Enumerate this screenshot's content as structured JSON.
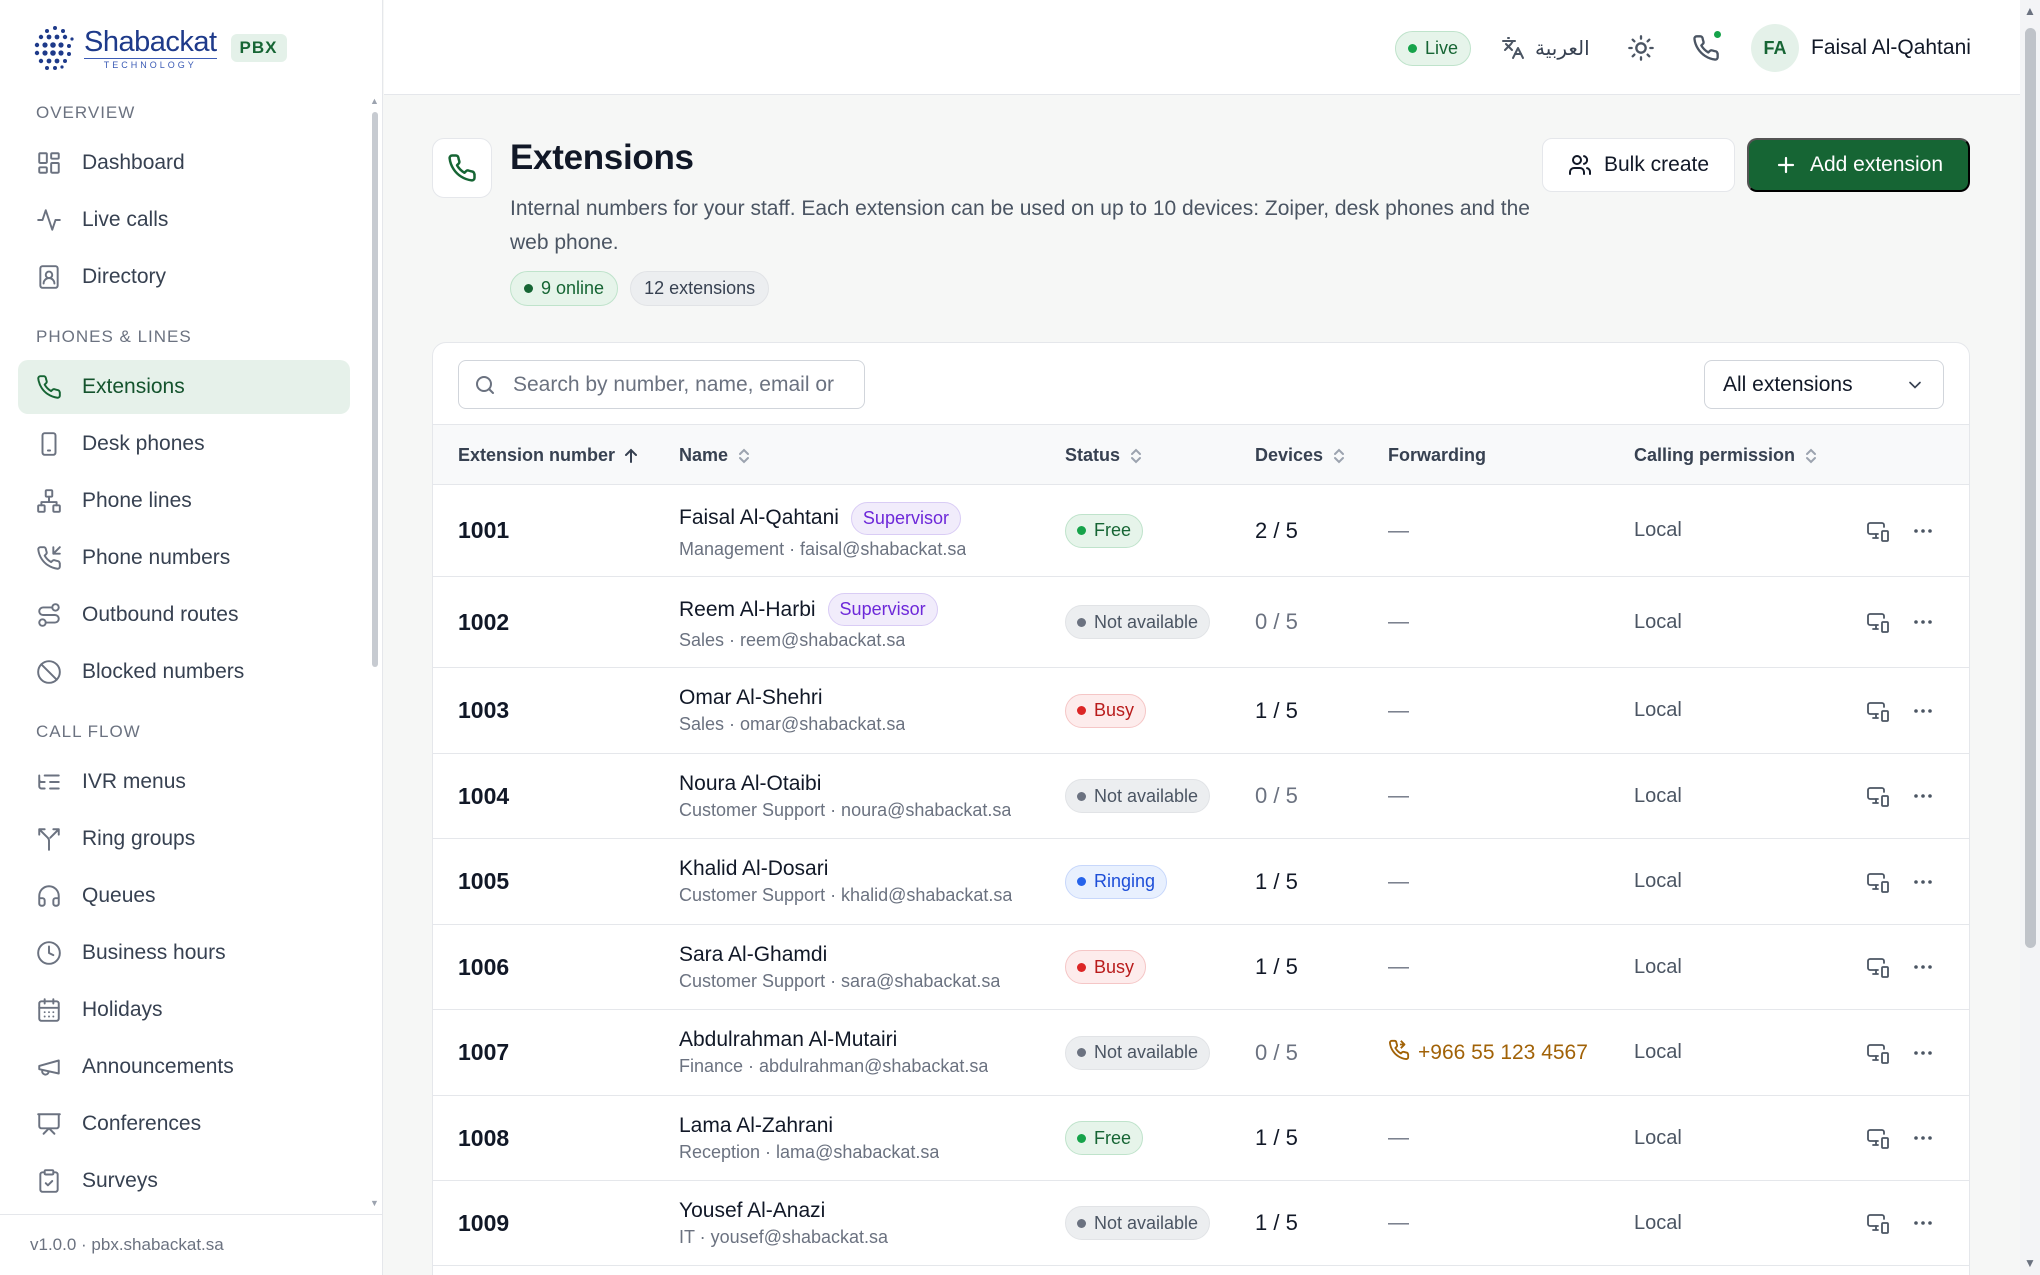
{
  "brand": {
    "name": "Shabackat",
    "subtitle": "TECHNOLOGY",
    "badge": "PBX"
  },
  "colors": {
    "accent": "#166534",
    "accent_soft": "#e6f1ea",
    "supervisor": "#6d28d9",
    "busy": "#b91c1c",
    "ringing": "#1d4ed8",
    "forward": "#a16207"
  },
  "sidebar": {
    "sections": [
      {
        "title": "OVERVIEW",
        "items": [
          {
            "label": "Dashboard",
            "icon": "dashboard-icon",
            "active": false
          },
          {
            "label": "Live calls",
            "icon": "activity-icon",
            "active": false
          },
          {
            "label": "Directory",
            "icon": "contact-book-icon",
            "active": false
          }
        ]
      },
      {
        "title": "PHONES & LINES",
        "items": [
          {
            "label": "Extensions",
            "icon": "phone-icon",
            "active": true
          },
          {
            "label": "Desk phones",
            "icon": "smartphone-icon",
            "active": false
          },
          {
            "label": "Phone lines",
            "icon": "network-icon",
            "active": false
          },
          {
            "label": "Phone numbers",
            "icon": "phone-incoming-icon",
            "active": false
          },
          {
            "label": "Outbound routes",
            "icon": "route-icon",
            "active": false
          },
          {
            "label": "Blocked numbers",
            "icon": "ban-icon",
            "active": false
          }
        ]
      },
      {
        "title": "CALL FLOW",
        "items": [
          {
            "label": "IVR menus",
            "icon": "list-tree-icon",
            "active": false
          },
          {
            "label": "Ring groups",
            "icon": "split-icon",
            "active": false
          },
          {
            "label": "Queues",
            "icon": "headphones-icon",
            "active": false
          },
          {
            "label": "Business hours",
            "icon": "clock-icon",
            "active": false
          },
          {
            "label": "Holidays",
            "icon": "calendar-icon",
            "active": false
          },
          {
            "label": "Announcements",
            "icon": "megaphone-icon",
            "active": false
          },
          {
            "label": "Conferences",
            "icon": "presentation-icon",
            "active": false
          },
          {
            "label": "Surveys",
            "icon": "clipboard-check-icon",
            "active": false
          }
        ]
      }
    ],
    "version": "v1.0.0 · pbx.shabackat.sa"
  },
  "topbar": {
    "live_label": "Live",
    "language_label": "العربية",
    "user_initials": "FA",
    "user_name": "Faisal Al-Qahtani"
  },
  "page": {
    "title": "Extensions",
    "description": "Internal numbers for your staff. Each extension can be used on up to 10 devices: Zoiper, desk phones and the web phone.",
    "online_chip": "9 online",
    "count_chip": "12 extensions",
    "bulk_create_label": "Bulk create",
    "add_extension_label": "Add extension"
  },
  "search": {
    "placeholder": "Search by number, name, email or",
    "value": ""
  },
  "filter": {
    "selected": "All extensions"
  },
  "table": {
    "columns": [
      "Extension number",
      "Name",
      "Status",
      "Devices",
      "Forwarding",
      "Calling permission"
    ],
    "rows": [
      {
        "ext": "1001",
        "name": "Faisal Al-Qahtani",
        "role": "Supervisor",
        "sub": "Management · faisal@shabackat.sa",
        "status": "Free",
        "status_kind": "free",
        "devices": "2 / 5",
        "devices_active": true,
        "forwarding": "—",
        "permission": "Local"
      },
      {
        "ext": "1002",
        "name": "Reem Al-Harbi",
        "role": "Supervisor",
        "sub": "Sales · reem@shabackat.sa",
        "status": "Not available",
        "status_kind": "na",
        "devices": "0 / 5",
        "devices_active": false,
        "forwarding": "—",
        "permission": "Local"
      },
      {
        "ext": "1003",
        "name": "Omar Al-Shehri",
        "role": "",
        "sub": "Sales · omar@shabackat.sa",
        "status": "Busy",
        "status_kind": "busy",
        "devices": "1 / 5",
        "devices_active": true,
        "forwarding": "—",
        "permission": "Local"
      },
      {
        "ext": "1004",
        "name": "Noura Al-Otaibi",
        "role": "",
        "sub": "Customer Support · noura@shabackat.sa",
        "status": "Not available",
        "status_kind": "na",
        "devices": "0 / 5",
        "devices_active": false,
        "forwarding": "—",
        "permission": "Local"
      },
      {
        "ext": "1005",
        "name": "Khalid Al-Dosari",
        "role": "",
        "sub": "Customer Support · khalid@shabackat.sa",
        "status": "Ringing",
        "status_kind": "ring",
        "devices": "1 / 5",
        "devices_active": true,
        "forwarding": "—",
        "permission": "Local"
      },
      {
        "ext": "1006",
        "name": "Sara Al-Ghamdi",
        "role": "",
        "sub": "Customer Support · sara@shabackat.sa",
        "status": "Busy",
        "status_kind": "busy",
        "devices": "1 / 5",
        "devices_active": true,
        "forwarding": "—",
        "permission": "Local"
      },
      {
        "ext": "1007",
        "name": "Abdulrahman Al-Mutairi",
        "role": "",
        "sub": "Finance · abdulrahman@shabackat.sa",
        "status": "Not available",
        "status_kind": "na",
        "devices": "0 / 5",
        "devices_active": false,
        "forwarding": "+966 55 123 4567",
        "permission": "Local"
      },
      {
        "ext": "1008",
        "name": "Lama Al-Zahrani",
        "role": "",
        "sub": "Reception · lama@shabackat.sa",
        "status": "Free",
        "status_kind": "free",
        "devices": "1 / 5",
        "devices_active": true,
        "forwarding": "—",
        "permission": "Local"
      },
      {
        "ext": "1009",
        "name": "Yousef Al-Anazi",
        "role": "",
        "sub": "IT · yousef@shabackat.sa",
        "status": "Not available",
        "status_kind": "na",
        "devices": "1 / 5",
        "devices_active": true,
        "forwarding": "—",
        "permission": "Local"
      }
    ]
  }
}
